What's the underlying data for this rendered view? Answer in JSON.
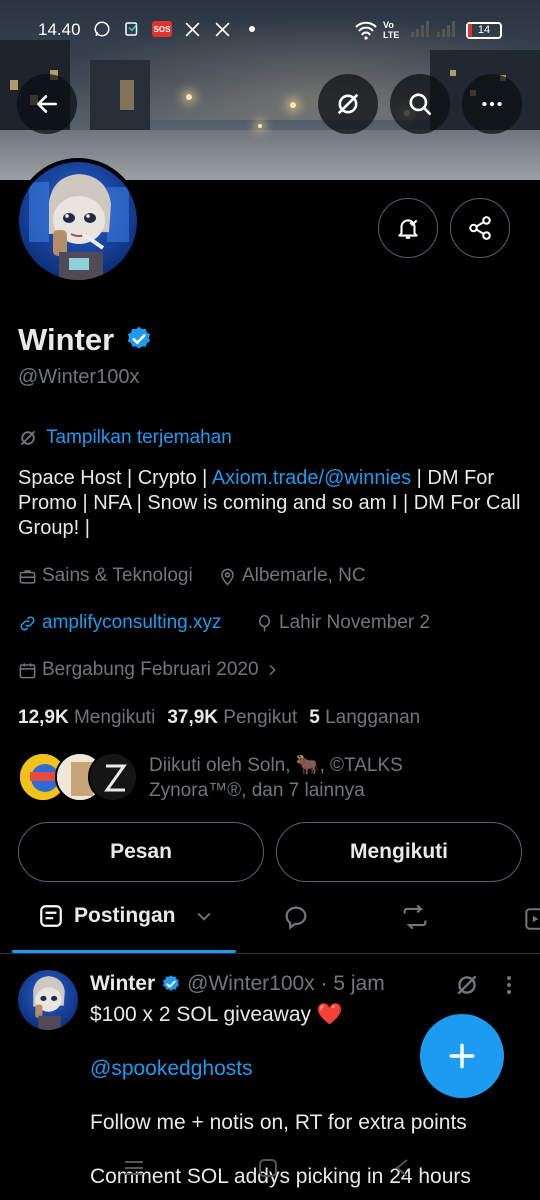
{
  "status_bar": {
    "time": "14.40",
    "sos": "SOS",
    "network_label": "Vo LTE",
    "battery": "14"
  },
  "profile": {
    "name": "Winter",
    "handle": "@Winter100x",
    "translate_label": "Tampilkan terjemahan",
    "bio_prefix": "Space Host | Crypto | ",
    "bio_link": "Axiom.trade/@winnies",
    "bio_suffix": " | DM For Promo | NFA | Snow is coming and so am I | DM For Call Group! |",
    "category": "Sains & Teknologi",
    "location": "Albemarle, NC",
    "website": "amplifyconsulting.xyz",
    "birthday": "Lahir November 2",
    "joined": "Bergabung Februari 2020",
    "following_count": "12,9K",
    "following_label": "Mengikuti",
    "followers_count": "37,9K",
    "followers_label": "Pengikut",
    "subscriptions_count": "5",
    "subscriptions_label": "Langganan",
    "followed_by": "Diikuti oleh Soln, 🐂, ©TALKS Zynora™®, dan 7 lainnya"
  },
  "actions": {
    "message": "Pesan",
    "following": "Mengikuti"
  },
  "tabs": {
    "active": "Postingan"
  },
  "post": {
    "name": "Winter",
    "handle_time": "@Winter100x · 5 jam",
    "line1": "$100 x 2 SOL giveaway ❤️",
    "mention": "@spookedghosts",
    "line2": "Follow me + notis on, RT for extra points",
    "line3": "Comment SOL addys picking in 24 hours"
  },
  "colors": {
    "accent": "#1d9bf0",
    "background": "#000000",
    "muted": "#71767b",
    "text": "#e7e9ea"
  }
}
